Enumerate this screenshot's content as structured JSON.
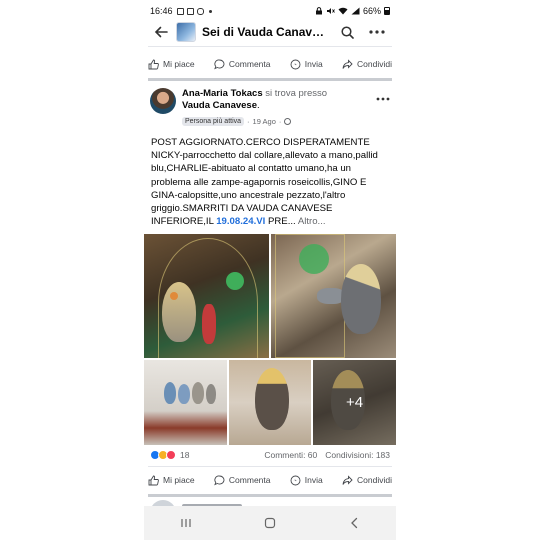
{
  "status_bar": {
    "time": "16:46",
    "battery": "66%"
  },
  "header": {
    "title": "Sei di Vauda Canavese..."
  },
  "top_actions": {
    "like": "Mi piace",
    "comment": "Commenta",
    "send": "Invia",
    "share": "Condividi"
  },
  "post": {
    "author": "Ana-Maria Tokacs",
    "presso": "si trova presso",
    "group": "Vauda Canavese",
    "badge": "Persona più attiva",
    "time": "19 Ago",
    "text_before": "POST AGGIORNATO.CERCO DISPERATAMENTE NICKY-parrocchetto dal collare,allevato a mano,pallid blu,CHARLIE-abituato al contatto umano,ha un problema alle zampe-agapornis roseicollis,GINO E GINA-calopsitte,uno ancestrale pezzato,l'altro griggio.SMARRITI DA VAUDA CANAVESE INFERIORE,IL ",
    "text_highlight": "19.08.24.VI",
    "text_after": " PRE...",
    "more_label": "Altro...",
    "extra_photos": "+4",
    "reactions_count": "18",
    "comments": "Commenti: 60",
    "shares": "Condivisioni: 183"
  },
  "bottom_actions": {
    "like": "Mi piace",
    "comment": "Commenta",
    "send": "Invia",
    "share": "Condividi"
  },
  "colors": {
    "accent": "#216fdb",
    "like": "#1877f2",
    "divider": "#c9ccd1"
  }
}
